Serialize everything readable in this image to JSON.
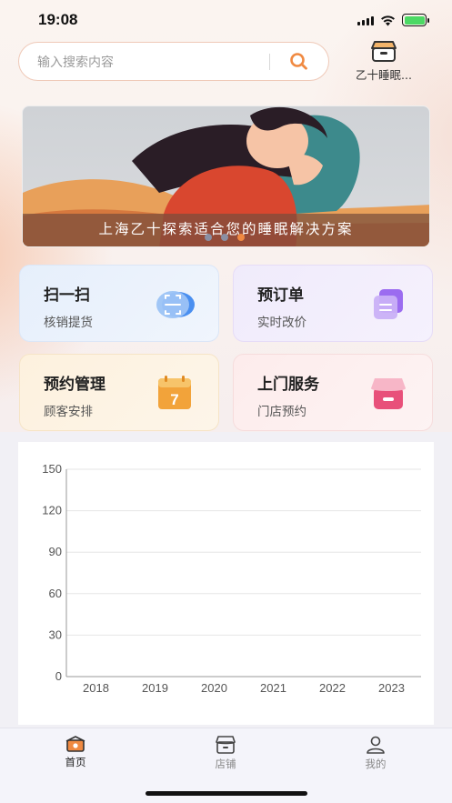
{
  "status_bar": {
    "time": "19:08"
  },
  "search": {
    "placeholder": "输入搜索内容"
  },
  "store": {
    "label": "乙十睡眠..."
  },
  "banner": {
    "caption": "上海乙十探索适合您的睡眠解决方案",
    "active_slide": 3,
    "slide_count": 3
  },
  "cards": [
    {
      "title": "扫一扫",
      "subtitle": "核销提货",
      "icon": "scan-icon"
    },
    {
      "title": "预订单",
      "subtitle": "实时改价",
      "icon": "order-icon"
    },
    {
      "title": "预约管理",
      "subtitle": "顾客安排",
      "icon": "calendar-icon",
      "icon_text": "7"
    },
    {
      "title": "上门服务",
      "subtitle": "门店预约",
      "icon": "shop-icon"
    }
  ],
  "chart_data": {
    "type": "line",
    "categories": [
      "2018",
      "2019",
      "2020",
      "2021",
      "2022",
      "2023"
    ],
    "series": [],
    "yticks": [
      "0",
      "30",
      "60",
      "90",
      "120",
      "150"
    ],
    "ylim": [
      0,
      150
    ],
    "grid": true
  },
  "tabbar": {
    "tabs": [
      {
        "label": "首页",
        "icon": "home-icon",
        "active": true
      },
      {
        "label": "店铺",
        "icon": "store-icon",
        "active": false
      },
      {
        "label": "我的",
        "icon": "user-icon",
        "active": false
      }
    ]
  },
  "colors": {
    "accent": "#f08a42",
    "active_dot": "#f08a42"
  }
}
